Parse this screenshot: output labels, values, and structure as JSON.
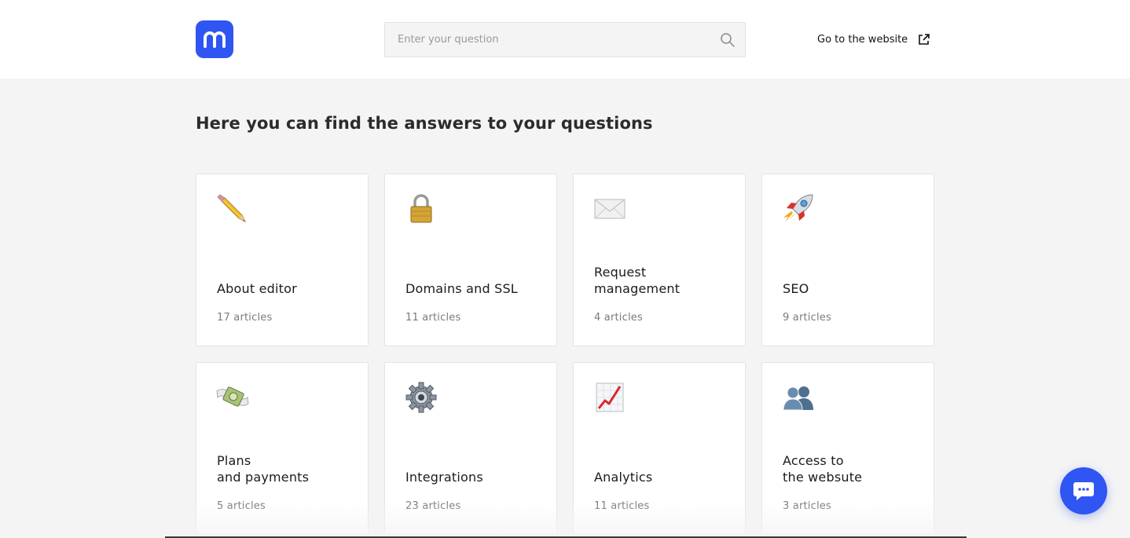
{
  "header": {
    "logo_icon": "m-logo-icon",
    "search": {
      "placeholder": "Enter your question",
      "value": ""
    },
    "goto_label": "Go to the website"
  },
  "main": {
    "heading": "Here you can find the answers to your questions",
    "categories": [
      {
        "title": "About editor",
        "count": "17 articles",
        "icon": "pencil-icon"
      },
      {
        "title": "Domains and SSL",
        "count": "11 articles",
        "icon": "lock-icon"
      },
      {
        "title": "Request management",
        "title_lines": [
          "Request",
          "management"
        ],
        "count": "4 articles",
        "icon": "envelope-icon"
      },
      {
        "title": "SEO",
        "count": "9 articles",
        "icon": "rocket-icon"
      },
      {
        "title_lines": [
          "Plans",
          "and payments"
        ],
        "count": "5 articles",
        "icon": "money-with-wings-icon"
      },
      {
        "title": "Integrations",
        "count": "23 articles",
        "icon": "gear-icon"
      },
      {
        "title": "Analytics",
        "count": "11 articles",
        "icon": "chart-increasing-icon"
      },
      {
        "title_lines": [
          "Access to",
          "the websute"
        ],
        "count": "3 articles",
        "icon": "busts-icon"
      }
    ]
  },
  "colors": {
    "accent": "#2f55f2",
    "background": "#f4f4f4",
    "card": "#ffffff"
  },
  "chat": {
    "icon": "chat-bubble-icon"
  }
}
